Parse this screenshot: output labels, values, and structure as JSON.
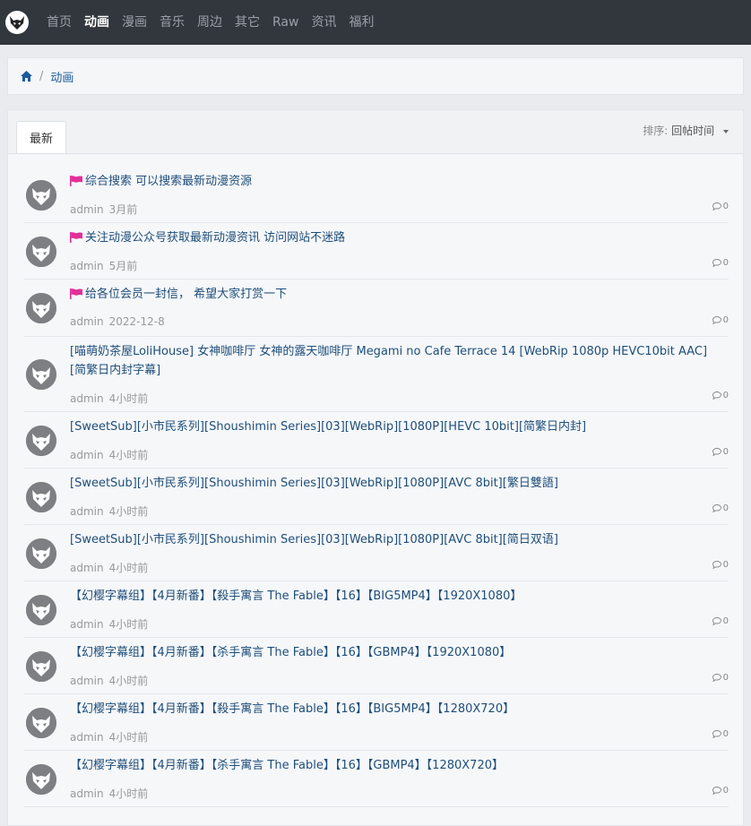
{
  "nav": {
    "items": [
      "首页",
      "动画",
      "漫画",
      "音乐",
      "周边",
      "其它",
      "Raw",
      "资讯",
      "福利"
    ],
    "active_index": 1
  },
  "breadcrumb": {
    "current": "动画"
  },
  "panel": {
    "tab_label": "最新",
    "sort_label": "排序:",
    "sort_value": "回帖时间"
  },
  "threads": [
    {
      "pinned": true,
      "title": "综合搜索 可以搜索最新动漫资源",
      "author": "admin",
      "time": "3月前",
      "replies": "0"
    },
    {
      "pinned": true,
      "title": "关注动漫公众号获取最新动漫资讯 访问网站不迷路",
      "author": "admin",
      "time": "5月前",
      "replies": "0"
    },
    {
      "pinned": true,
      "title": "给各位会员一封信， 希望大家打赏一下",
      "author": "admin",
      "time": "2022-12-8",
      "replies": "0"
    },
    {
      "pinned": false,
      "title": "[喵萌奶茶屋LoliHouse] 女神咖啡厅 女神的露天咖啡厅 Megami no Cafe Terrace 14 [WebRip 1080p HEVC10bit AAC][简繁日内封字幕]",
      "author": "admin",
      "time": "4小时前",
      "replies": "0"
    },
    {
      "pinned": false,
      "title": "[SweetSub][小市民系列][Shoushimin Series][03][WebRip][1080P][HEVC 10bit][简繁日内封]",
      "author": "admin",
      "time": "4小时前",
      "replies": "0"
    },
    {
      "pinned": false,
      "title": "[SweetSub][小市民系列][Shoushimin Series][03][WebRip][1080P][AVC 8bit][繁日雙語]",
      "author": "admin",
      "time": "4小时前",
      "replies": "0"
    },
    {
      "pinned": false,
      "title": "[SweetSub][小市民系列][Shoushimin Series][03][WebRip][1080P][AVC 8bit][简日双语]",
      "author": "admin",
      "time": "4小时前",
      "replies": "0"
    },
    {
      "pinned": false,
      "title": "【幻樱字幕组】【4月新番】【殺手寓言 The Fable】【16】【BIG5MP4】【1920X1080】",
      "author": "admin",
      "time": "4小时前",
      "replies": "0"
    },
    {
      "pinned": false,
      "title": "【幻樱字幕组】【4月新番】【杀手寓言 The Fable】【16】【GBMP4】【1920X1080】",
      "author": "admin",
      "time": "4小时前",
      "replies": "0"
    },
    {
      "pinned": false,
      "title": "【幻樱字幕组】【4月新番】【殺手寓言 The Fable】【16】【BIG5MP4】【1280X720】",
      "author": "admin",
      "time": "4小时前",
      "replies": "0"
    },
    {
      "pinned": false,
      "title": "【幻樱字幕组】【4月新番】【杀手寓言 The Fable】【16】【GBMP4】【1280X720】",
      "author": "admin",
      "time": "4小时前",
      "replies": "0"
    }
  ],
  "icons": {
    "logo": "horned-mask-logo-icon",
    "home": "home-icon",
    "pin": "flag-icon",
    "replies": "comment-bubble-icon",
    "avatar": "horned-mask-avatar-icon"
  },
  "colors": {
    "navbar_bg": "#32363d",
    "link": "#1f4e7a",
    "pin_flag": "#e0309a",
    "avatar_bg": "#7d7f83"
  }
}
